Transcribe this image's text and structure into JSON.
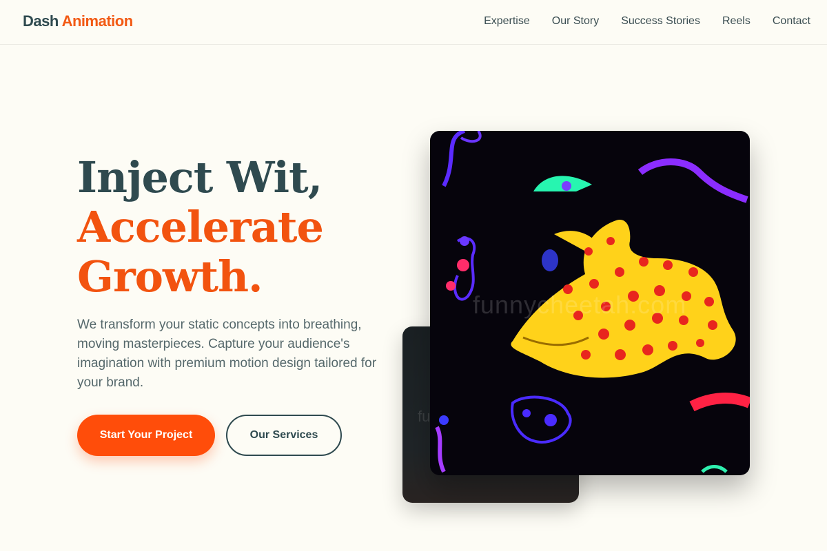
{
  "brand": {
    "name_part1": "Dash",
    "name_part2": "Animation"
  },
  "nav": {
    "links": [
      "Expertise",
      "Our Story",
      "Success Stories",
      "Reels",
      "Contact"
    ]
  },
  "hero": {
    "title_line1": "Inject Wit,",
    "title_line2": "Accelerate",
    "title_line3": "Growth.",
    "description": "We transform your static concepts into breathing, moving masterpieces. Capture your audience's imagination with premium motion design tailored for your brand.",
    "primary_cta": "Start Your Project",
    "secondary_cta": "Our Services"
  },
  "media": {
    "watermark": "funnycheetah.com",
    "back_watermark": "fu"
  },
  "colors": {
    "accent": "#f2530f",
    "primary_button": "#ff4d0a",
    "dark_text": "#2f4a4f",
    "background": "#fdfcf5"
  }
}
